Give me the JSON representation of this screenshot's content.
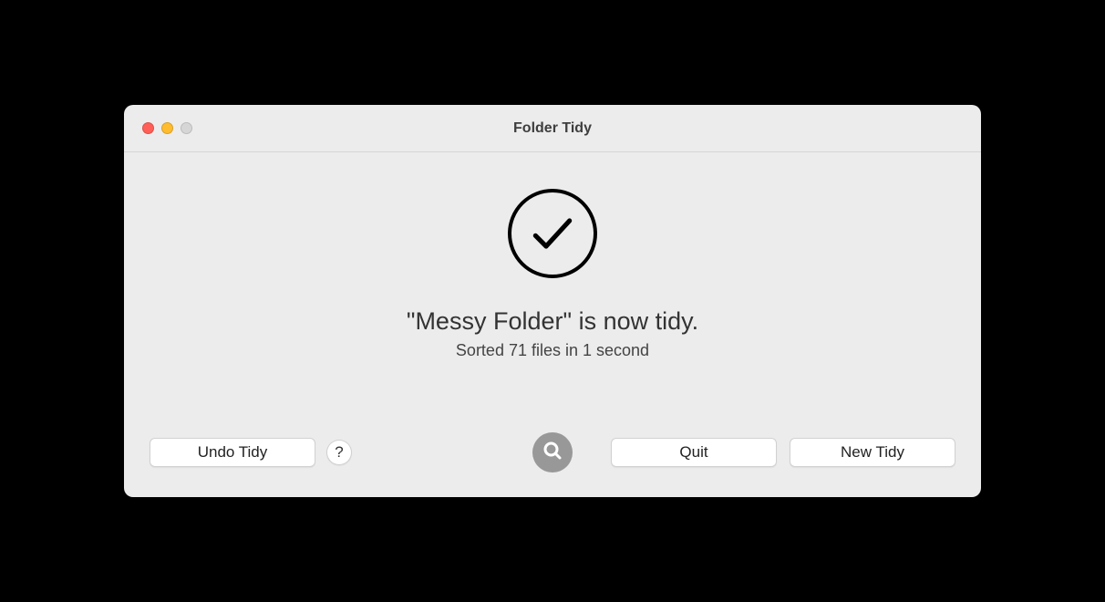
{
  "window": {
    "title": "Folder Tidy"
  },
  "main": {
    "headline": "\"Messy Folder\" is now tidy.",
    "subline": "Sorted 71 files in 1 second"
  },
  "footer": {
    "undo_label": "Undo Tidy",
    "help_label": "?",
    "quit_label": "Quit",
    "new_tidy_label": "New Tidy"
  }
}
